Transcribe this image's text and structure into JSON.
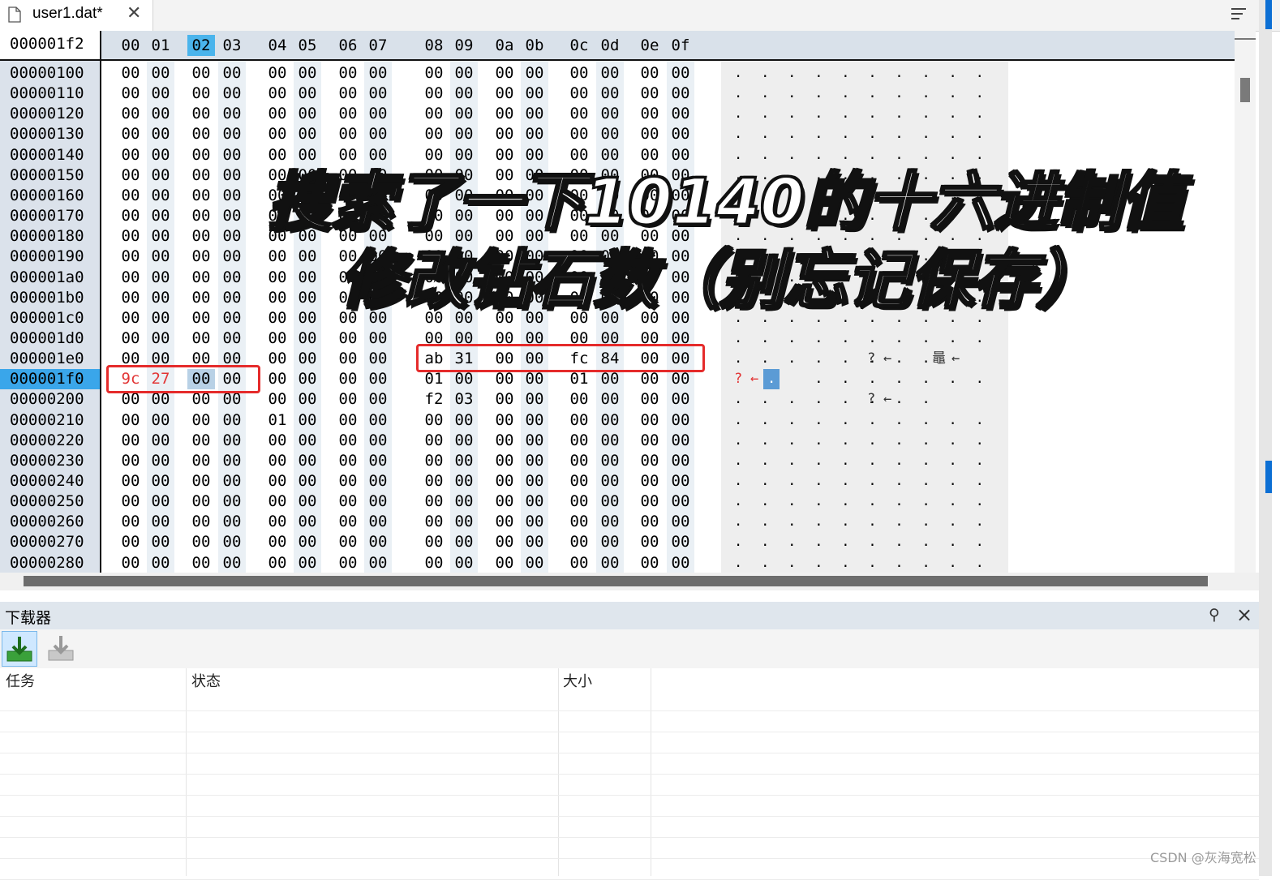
{
  "tab": {
    "title": "user1.dat*",
    "close": "✕"
  },
  "editor": {
    "cursor_offset": "000001f2",
    "columns": [
      "00",
      "01",
      "02",
      "03",
      "04",
      "05",
      "06",
      "07",
      "08",
      "09",
      "0a",
      "0b",
      "0c",
      "0d",
      "0e",
      "0f"
    ],
    "selected_column": "02",
    "selected_row": "000001f0",
    "rows": [
      {
        "offset": "00000100",
        "bytes": [
          "00",
          "00",
          "00",
          "00",
          "00",
          "00",
          "00",
          "00",
          "00",
          "00",
          "00",
          "00",
          "00",
          "00",
          "00",
          "00"
        ]
      },
      {
        "offset": "00000110",
        "bytes": [
          "00",
          "00",
          "00",
          "00",
          "00",
          "00",
          "00",
          "00",
          "00",
          "00",
          "00",
          "00",
          "00",
          "00",
          "00",
          "00"
        ]
      },
      {
        "offset": "00000120",
        "bytes": [
          "00",
          "00",
          "00",
          "00",
          "00",
          "00",
          "00",
          "00",
          "00",
          "00",
          "00",
          "00",
          "00",
          "00",
          "00",
          "00"
        ]
      },
      {
        "offset": "00000130",
        "bytes": [
          "00",
          "00",
          "00",
          "00",
          "00",
          "00",
          "00",
          "00",
          "00",
          "00",
          "00",
          "00",
          "00",
          "00",
          "00",
          "00"
        ]
      },
      {
        "offset": "00000140",
        "bytes": [
          "00",
          "00",
          "00",
          "00",
          "00",
          "00",
          "00",
          "00",
          "00",
          "00",
          "00",
          "00",
          "00",
          "00",
          "00",
          "00"
        ]
      },
      {
        "offset": "00000150",
        "bytes": [
          "00",
          "00",
          "00",
          "00",
          "00",
          "00",
          "00",
          "00",
          "00",
          "00",
          "00",
          "00",
          "00",
          "00",
          "00",
          "00"
        ]
      },
      {
        "offset": "00000160",
        "bytes": [
          "00",
          "00",
          "00",
          "00",
          "00",
          "00",
          "00",
          "00",
          "00",
          "00",
          "00",
          "00",
          "00",
          "00",
          "00",
          "00"
        ]
      },
      {
        "offset": "00000170",
        "bytes": [
          "00",
          "00",
          "00",
          "00",
          "00",
          "00",
          "00",
          "00",
          "00",
          "00",
          "00",
          "00",
          "00",
          "00",
          "00",
          "00"
        ]
      },
      {
        "offset": "00000180",
        "bytes": [
          "00",
          "00",
          "00",
          "00",
          "00",
          "00",
          "00",
          "00",
          "00",
          "00",
          "00",
          "00",
          "00",
          "00",
          "00",
          "00"
        ]
      },
      {
        "offset": "00000190",
        "bytes": [
          "00",
          "00",
          "00",
          "00",
          "00",
          "00",
          "00",
          "00",
          "00",
          "00",
          "00",
          "00",
          "00",
          "00",
          "00",
          "00"
        ]
      },
      {
        "offset": "000001a0",
        "bytes": [
          "00",
          "00",
          "00",
          "00",
          "00",
          "00",
          "00",
          "00",
          "00",
          "00",
          "00",
          "00",
          "00",
          "00",
          "00",
          "00"
        ]
      },
      {
        "offset": "000001b0",
        "bytes": [
          "00",
          "00",
          "00",
          "00",
          "00",
          "00",
          "00",
          "00",
          "00",
          "00",
          "00",
          "00",
          "00",
          "00",
          "00",
          "00"
        ]
      },
      {
        "offset": "000001c0",
        "bytes": [
          "00",
          "00",
          "00",
          "00",
          "00",
          "00",
          "00",
          "00",
          "00",
          "00",
          "00",
          "00",
          "00",
          "00",
          "00",
          "00"
        ]
      },
      {
        "offset": "000001d0",
        "bytes": [
          "00",
          "00",
          "00",
          "00",
          "00",
          "00",
          "00",
          "00",
          "00",
          "00",
          "00",
          "00",
          "00",
          "00",
          "00",
          "00"
        ]
      },
      {
        "offset": "000001e0",
        "bytes": [
          "00",
          "00",
          "00",
          "00",
          "00",
          "00",
          "00",
          "00",
          "ab",
          "31",
          "00",
          "00",
          "fc",
          "84",
          "00",
          "00"
        ]
      },
      {
        "offset": "000001f0",
        "bytes": [
          "9c",
          "27",
          "00",
          "00",
          "00",
          "00",
          "00",
          "00",
          "01",
          "00",
          "00",
          "00",
          "01",
          "00",
          "00",
          "00"
        ]
      },
      {
        "offset": "00000200",
        "bytes": [
          "00",
          "00",
          "00",
          "00",
          "00",
          "00",
          "00",
          "00",
          "f2",
          "03",
          "00",
          "00",
          "00",
          "00",
          "00",
          "00"
        ]
      },
      {
        "offset": "00000210",
        "bytes": [
          "00",
          "00",
          "00",
          "00",
          "01",
          "00",
          "00",
          "00",
          "00",
          "00",
          "00",
          "00",
          "00",
          "00",
          "00",
          "00"
        ]
      },
      {
        "offset": "00000220",
        "bytes": [
          "00",
          "00",
          "00",
          "00",
          "00",
          "00",
          "00",
          "00",
          "00",
          "00",
          "00",
          "00",
          "00",
          "00",
          "00",
          "00"
        ]
      },
      {
        "offset": "00000230",
        "bytes": [
          "00",
          "00",
          "00",
          "00",
          "00",
          "00",
          "00",
          "00",
          "00",
          "00",
          "00",
          "00",
          "00",
          "00",
          "00",
          "00"
        ]
      },
      {
        "offset": "00000240",
        "bytes": [
          "00",
          "00",
          "00",
          "00",
          "00",
          "00",
          "00",
          "00",
          "00",
          "00",
          "00",
          "00",
          "00",
          "00",
          "00",
          "00"
        ]
      },
      {
        "offset": "00000250",
        "bytes": [
          "00",
          "00",
          "00",
          "00",
          "00",
          "00",
          "00",
          "00",
          "00",
          "00",
          "00",
          "00",
          "00",
          "00",
          "00",
          "00"
        ]
      },
      {
        "offset": "00000260",
        "bytes": [
          "00",
          "00",
          "00",
          "00",
          "00",
          "00",
          "00",
          "00",
          "00",
          "00",
          "00",
          "00",
          "00",
          "00",
          "00",
          "00"
        ]
      },
      {
        "offset": "00000270",
        "bytes": [
          "00",
          "00",
          "00",
          "00",
          "00",
          "00",
          "00",
          "00",
          "00",
          "00",
          "00",
          "00",
          "00",
          "00",
          "00",
          "00"
        ]
      },
      {
        "offset": "00000280",
        "bytes": [
          "00",
          "00",
          "00",
          "00",
          "00",
          "00",
          "00",
          "00",
          "00",
          "00",
          "00",
          "00",
          "00",
          "00",
          "00",
          "00"
        ]
      }
    ],
    "ascii_marks": {
      "row_1e0": [
        "?",
        "←",
        "鼂",
        "←"
      ],
      "row_1f0": [
        "?",
        "←",
        "."
      ],
      "row_200": [
        "?",
        "←"
      ]
    },
    "colors": {
      "highlight_red": "#e23535",
      "selection_blue": "#3aa6ea",
      "box_red": "#e52b2b"
    }
  },
  "caption": {
    "line1": "搜索了一下10140的十六进制值",
    "line2": "修改钻石数（别忘记保存）"
  },
  "downloader": {
    "title": "下载器",
    "columns": [
      "任务",
      "状态",
      "大小"
    ],
    "icons": [
      "download-icon",
      "download-disabled-icon",
      "pin-icon",
      "close-icon"
    ]
  },
  "watermark": "CSDN @灰海宽松"
}
